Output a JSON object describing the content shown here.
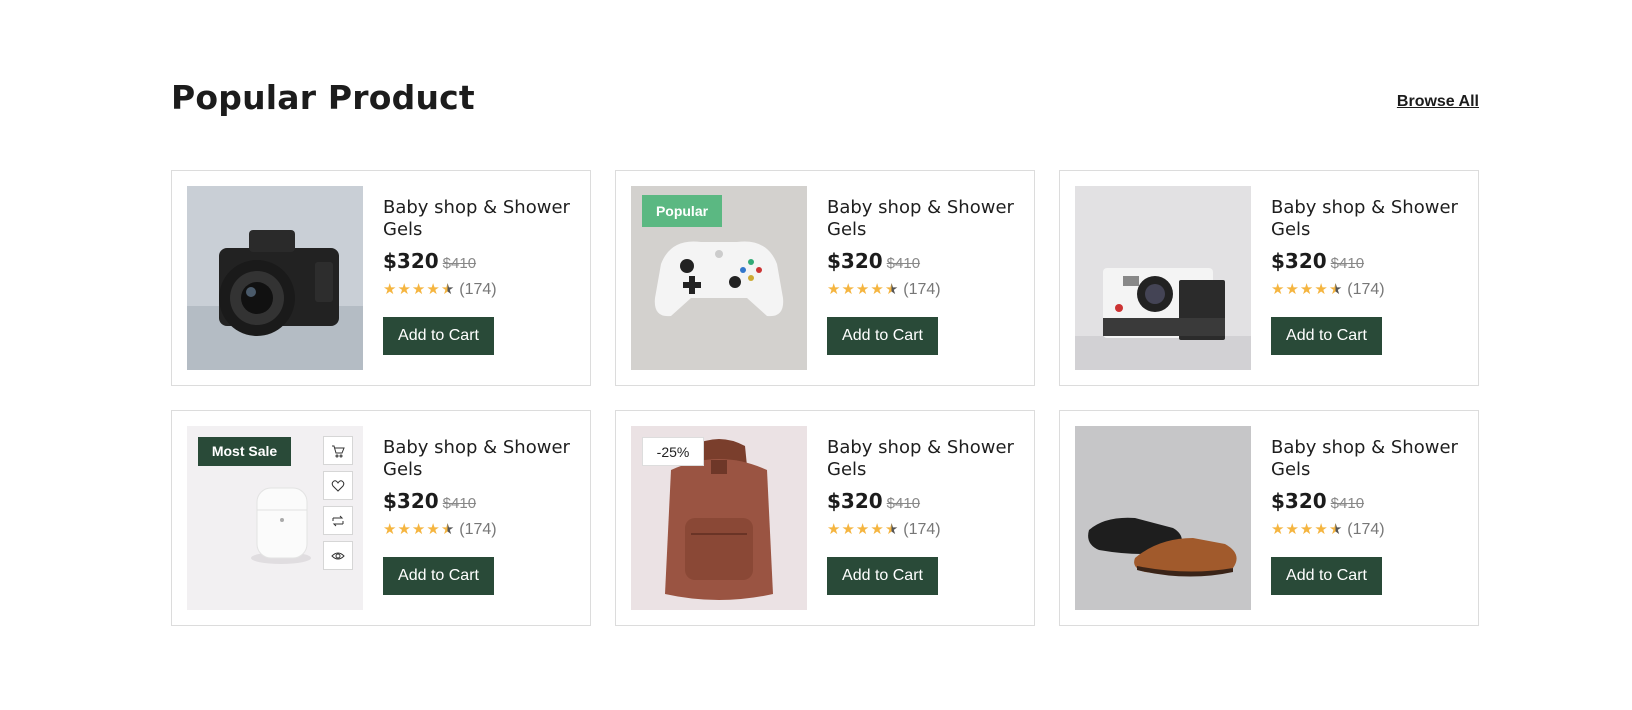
{
  "section": {
    "title": "Popular Product",
    "browse_label": "Browse All"
  },
  "products": [
    {
      "name": "Baby shop & Shower Gels",
      "price": "$320",
      "old_price": "$410",
      "rating": 4.5,
      "reviews": "(174)",
      "button": "Add to Cart",
      "image": "camera"
    },
    {
      "name": "Baby shop & Shower Gels",
      "price": "$320",
      "old_price": "$410",
      "rating": 4.5,
      "reviews": "(174)",
      "button": "Add to Cart",
      "image": "game-controller",
      "badge": "Popular"
    },
    {
      "name": "Baby shop & Shower Gels",
      "price": "$320",
      "old_price": "$410",
      "rating": 4.5,
      "reviews": "(174)",
      "button": "Add to Cart",
      "image": "instant-camera"
    },
    {
      "name": "Baby shop & Shower Gels",
      "price": "$320",
      "old_price": "$410",
      "rating": 4.5,
      "reviews": "(174)",
      "button": "Add to Cart",
      "image": "earbuds-case",
      "badge": "Most Sale",
      "actions": [
        "cart-icon",
        "heart-icon",
        "compare-icon",
        "eye-icon"
      ]
    },
    {
      "name": "Baby shop & Shower Gels",
      "price": "$320",
      "old_price": "$410",
      "rating": 4.5,
      "reviews": "(174)",
      "button": "Add to Cart",
      "image": "backpack",
      "badge": "-25%"
    },
    {
      "name": "Baby shop & Shower Gels",
      "price": "$320",
      "old_price": "$410",
      "rating": 4.5,
      "reviews": "(174)",
      "button": "Add to Cart",
      "image": "shoes"
    }
  ],
  "colors": {
    "button": "#294a38",
    "popular_badge": "#5bb882",
    "star": "#f5b540",
    "border": "#dcdcdc"
  }
}
